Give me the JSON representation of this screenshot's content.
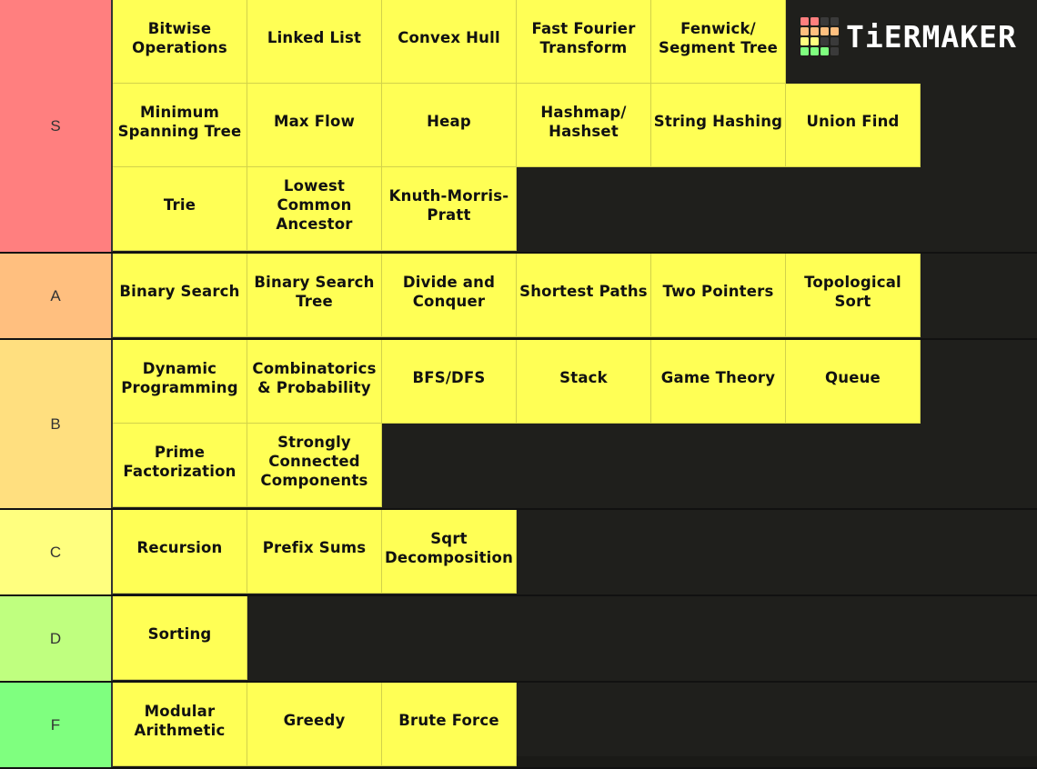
{
  "logo": {
    "text": "TiERMAKER",
    "grid": [
      [
        "#ff7f7f",
        "#ff7f7f",
        "#3a3a3a",
        "#3a3a3a"
      ],
      [
        "#ffbf7f",
        "#ffbf7f",
        "#ffbf7f",
        "#ffbf7f"
      ],
      [
        "#ffff7f",
        "#ffff7f",
        "#3a3a3a",
        "#3a3a3a"
      ],
      [
        "#7fff7f",
        "#7fff7f",
        "#7fff7f",
        "#3a3a3a"
      ]
    ]
  },
  "tiers": [
    {
      "label": "S",
      "color": "#ff7f7f",
      "items": [
        "Bitwise\nOperations",
        "Linked List",
        "Convex Hull",
        "Fast Fourier\nTransform",
        "Fenwick/\nSegment Tree",
        "Minimum\nSpanning Tree",
        "Max Flow",
        "Heap",
        "Hashmap/\nHashset",
        "String Hashing",
        "Union Find",
        "Trie",
        "Lowest\nCommon\nAncestor",
        "Knuth-Morris-\nPratt"
      ]
    },
    {
      "label": "A",
      "color": "#ffbf7f",
      "items": [
        "Binary Search",
        "Binary Search\nTree",
        "Divide and\nConquer",
        "Shortest Paths",
        "Two Pointers",
        "Topological\nSort"
      ]
    },
    {
      "label": "B",
      "color": "#ffdf7f",
      "items": [
        "Dynamic\nProgramming",
        "Combinatorics\n& Probability",
        "BFS/DFS",
        "Stack",
        "Game Theory",
        "Queue",
        "Prime\nFactorization",
        "Strongly\nConnected\nComponents"
      ]
    },
    {
      "label": "C",
      "color": "#ffff7f",
      "items": [
        "Recursion",
        "Prefix Sums",
        "Sqrt\nDecomposition"
      ]
    },
    {
      "label": "D",
      "color": "#bfff7f",
      "items": [
        "Sorting"
      ]
    },
    {
      "label": "F",
      "color": "#7fff7f",
      "items": [
        "Modular\nArithmetic",
        "Greedy",
        "Brute Force"
      ]
    }
  ]
}
